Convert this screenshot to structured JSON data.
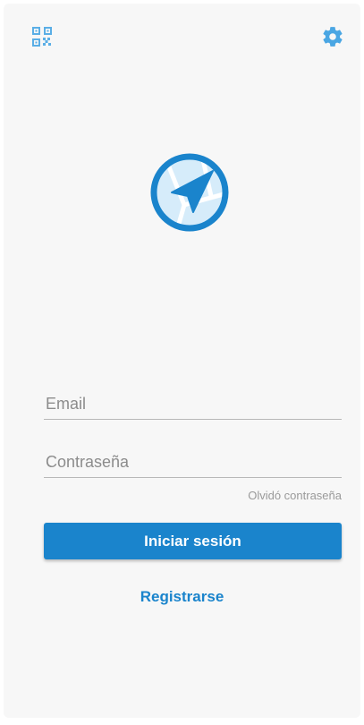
{
  "header": {
    "left_icon": "qr-code-icon",
    "right_icon": "gear-icon"
  },
  "logo": {
    "icon": "navigation-arrow-logo"
  },
  "form": {
    "email_placeholder": "Email",
    "email_value": "",
    "password_placeholder": "Contraseña",
    "password_value": "",
    "forgot_password_label": "Olvidó contraseña",
    "login_label": "Iniciar sesión",
    "register_label": "Registrarse"
  },
  "colors": {
    "accent": "#1a84cc",
    "background": "#f7f7f7",
    "icon_blue": "#4aa6e3"
  }
}
